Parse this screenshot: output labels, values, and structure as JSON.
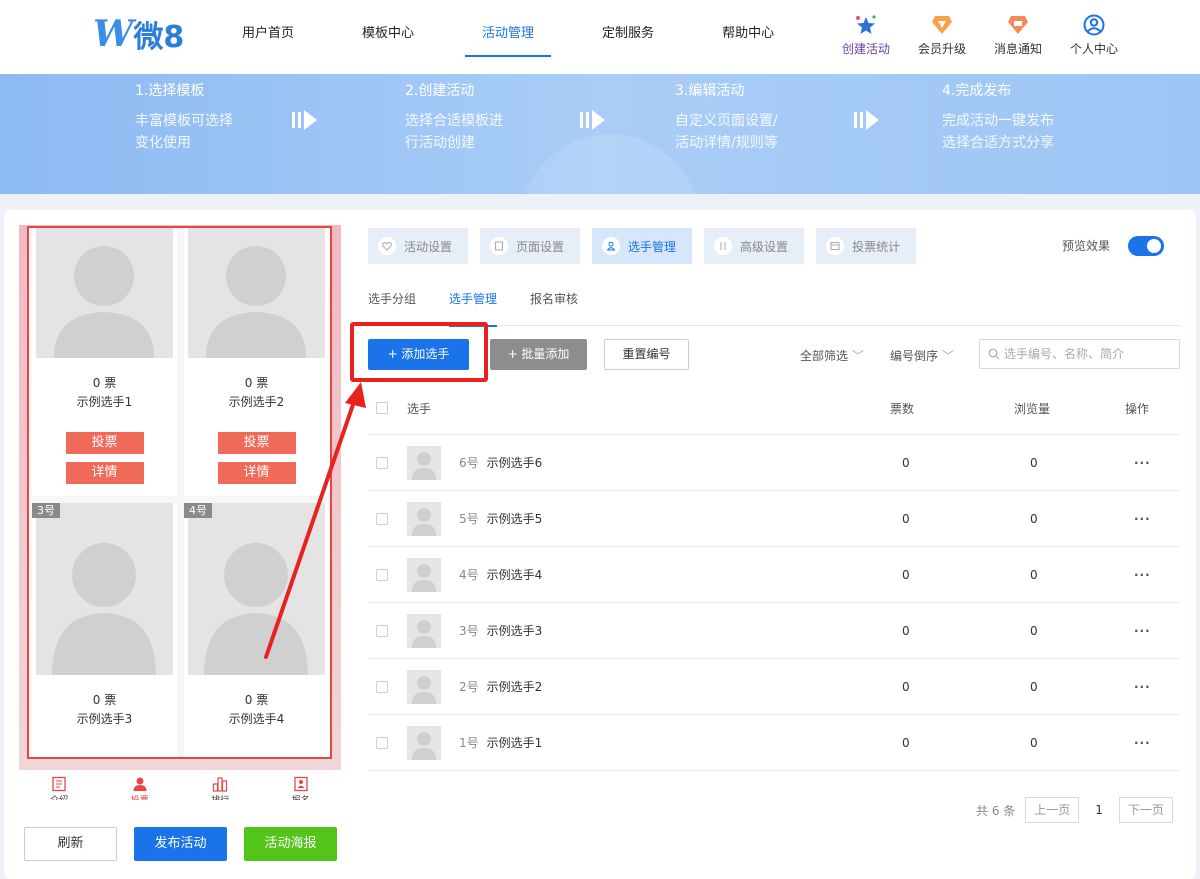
{
  "header": {
    "logo_text": "微8",
    "nav": [
      "用户首页",
      "模板中心",
      "活动管理",
      "定制服务",
      "帮助中心"
    ],
    "actions": [
      {
        "label": "创建活动",
        "icon": "stars-icon"
      },
      {
        "label": "会员升级",
        "icon": "vip-badge-icon"
      },
      {
        "label": "消息通知",
        "icon": "bell-badge-icon"
      },
      {
        "label": "个人中心",
        "icon": "user-circle-icon"
      }
    ]
  },
  "steps": [
    {
      "title": "1.选择模板",
      "line1": "丰富模板可选择",
      "line2": "变化使用"
    },
    {
      "title": "2.创建活动",
      "line1": "选择合适模板进",
      "line2": "行活动创建"
    },
    {
      "title": "3.编辑活动",
      "line1": "自定义页面设置/",
      "line2": "活动详情/规则等"
    },
    {
      "title": "4.完成发布",
      "line1": "完成活动一键发布",
      "line2": "选择合适方式分享"
    }
  ],
  "preview": {
    "cards": [
      {
        "votes": "0 票",
        "name": "示例选手1",
        "vote_btn": "投票",
        "detail_btn": "详情"
      },
      {
        "votes": "0 票",
        "name": "示例选手2",
        "vote_btn": "投票",
        "detail_btn": "详情"
      },
      {
        "num": "3号",
        "votes": "0 票",
        "name": "示例选手3"
      },
      {
        "num": "4号",
        "votes": "0 票",
        "name": "示例选手4"
      }
    ],
    "tabs": [
      "介绍",
      "投票",
      "排行",
      "报名"
    ]
  },
  "bottom_buttons": {
    "refresh": "刷新",
    "publish": "发布活动",
    "poster": "活动海报"
  },
  "settings_tabs": [
    "活动设置",
    "页面设置",
    "选手管理",
    "高级设置",
    "投票统计"
  ],
  "preview_toggle_label": "预览效果",
  "subtabs": [
    "选手分组",
    "选手管理",
    "报名审核"
  ],
  "toolbar": {
    "add": "+ 添加选手",
    "batch": "+ 批量添加",
    "reset": "重置编号",
    "filter_all": "全部筛选",
    "sort": "编号倒序",
    "search_placeholder": "选手编号、名称、简介"
  },
  "table": {
    "headers": {
      "player": "选手",
      "votes": "票数",
      "views": "浏览量",
      "ops": "操作"
    },
    "rows": [
      {
        "num": "6号",
        "name": "示例选手6",
        "votes": "0",
        "views": "0",
        "ops": "···"
      },
      {
        "num": "5号",
        "name": "示例选手5",
        "votes": "0",
        "views": "0",
        "ops": "···"
      },
      {
        "num": "4号",
        "name": "示例选手4",
        "votes": "0",
        "views": "0",
        "ops": "···"
      },
      {
        "num": "3号",
        "name": "示例选手3",
        "votes": "0",
        "views": "0",
        "ops": "···"
      },
      {
        "num": "2号",
        "name": "示例选手2",
        "votes": "0",
        "views": "0",
        "ops": "···"
      },
      {
        "num": "1号",
        "name": "示例选手1",
        "votes": "0",
        "views": "0",
        "ops": "···"
      }
    ]
  },
  "pagination": {
    "total": "共 6 条",
    "prev": "上一页",
    "current": "1",
    "next": "下一页"
  },
  "colors": {
    "primary": "#1a73e8",
    "highlight": "#e8221f",
    "vote_btn": "#f06a5a",
    "poster": "#52c41a"
  }
}
